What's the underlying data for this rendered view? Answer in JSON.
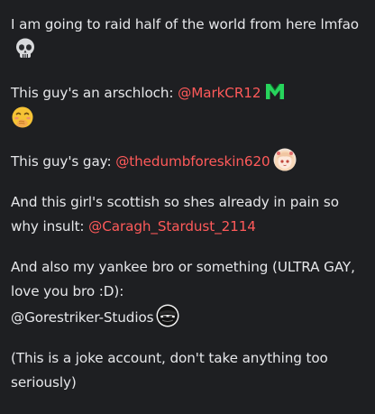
{
  "bio": {
    "line1": "I am going to raid half of the world from here lmfao",
    "line2_prefix": "This guy's an arschloch: ",
    "line2_mention": "@MarkCR12",
    "line3_prefix": "This guy's gay: ",
    "line3_mention": "@thedumbforeskin620",
    "line4_prefix": "And this girl's scottish so shes already in pain so why insult: ",
    "line4_mention": "@Caragh_Stardust_2114",
    "line5_text": "And also my yankee bro or something (ULTRA GAY, love you bro :D):",
    "line5_mention": "@Gorestriker-Studios",
    "line6": "(This is a joke account, don't take anything too seriously)"
  },
  "icons": {
    "skull": "skull-emoji-icon",
    "m_logo": "green-m-logo-icon",
    "giggle": "hand-over-mouth-emoji-icon",
    "anime_avatar": "anime-avatar-icon",
    "mask_avatar": "mask-avatar-icon"
  },
  "colors": {
    "background": "#1e1f22",
    "text": "#e6e7ea",
    "mention": "#ff5a5a",
    "m_logo_green": "#27d45c"
  }
}
